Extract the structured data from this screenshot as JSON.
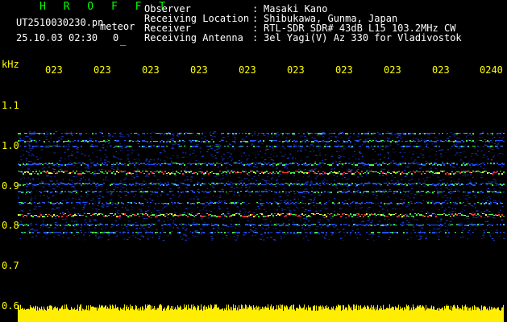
{
  "header": {
    "brand": "H R O F F T",
    "filename": "UT2510030230.pn",
    "meteor_label": "meteor",
    "datetime": "25.10.03 02:30",
    "count": "0",
    "count_suffix": "_",
    "fields": [
      {
        "label": "Observer",
        "sep": ":",
        "value": "Masaki Kano"
      },
      {
        "label": "Receiving Location",
        "sep": ":",
        "value": "Shibukawa, Gunma, Japan"
      },
      {
        "label": "Receiver",
        "sep": ":",
        "value": "RTL-SDR SDR# 43dB L15 103.2MHz CW"
      },
      {
        "label": "Receiving Antenna",
        "sep": ":",
        "value": "3el Yagi(V) Az 330 for Vladivostok"
      }
    ]
  },
  "axes": {
    "y_unit": "kHz",
    "y_ticks": [
      "1.1",
      "1.0",
      "0.9",
      "0.8",
      "0.7",
      "0.6"
    ],
    "x_ticks": [
      "023",
      "023",
      "023",
      "023",
      "023",
      "023",
      "023",
      "023",
      "023",
      "0240"
    ]
  },
  "colors": {
    "background": "#000000",
    "header_text": "#ffffff",
    "brand": "#00ff00",
    "axis_text": "#ffff00",
    "noise_floor": "#ffee00",
    "signal_red": "#ff3030",
    "signal_green": "#40ff40",
    "signal_blue": "#2050ff"
  }
}
